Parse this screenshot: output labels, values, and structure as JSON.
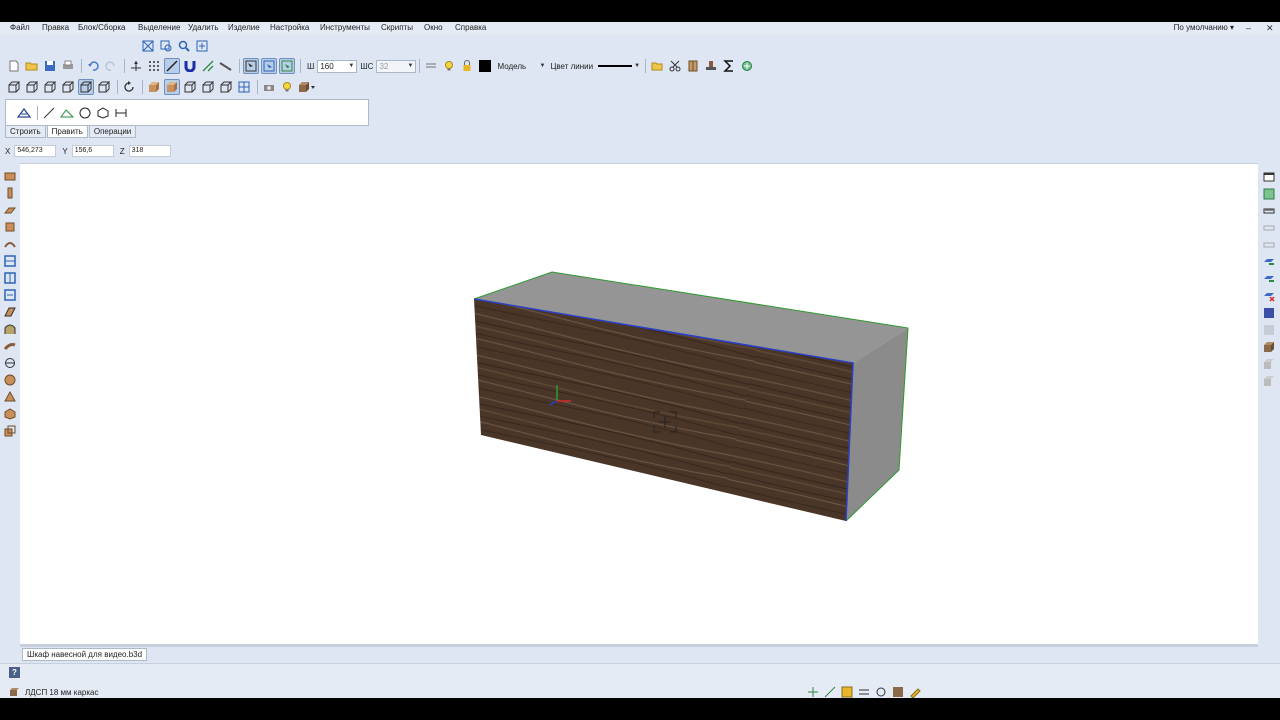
{
  "menu": [
    "Файл",
    "Правка",
    "Блок/Сборка",
    "Выделение",
    "Удалить",
    "Изделие",
    "Настройка",
    "Инструменты",
    "Скрипты",
    "Окно",
    "Справка"
  ],
  "preset": "По умолчанию ▾",
  "window_controls": {
    "minimize": "–",
    "close": "✕"
  },
  "toolbar": {
    "width_label": "Ш",
    "width_value": "160",
    "ws_label": "ШС",
    "ws_value": "32",
    "layer_value": "Модель",
    "line_color_label": "Цвет линии"
  },
  "draw_tabs": [
    "Строить",
    "Править",
    "Операции"
  ],
  "coords": {
    "x_label": "X",
    "x_value": "546,273",
    "y_label": "Y",
    "y_value": "156,6",
    "z_label": "Z",
    "z_value": "318"
  },
  "document_tab": "Шкаф навесной для видео.b3d",
  "status": {
    "help": "?",
    "material": "ЛДСП 18 мм каркас"
  },
  "colors": {
    "wood": "#4a3628",
    "panel_gray": "#8f8f8f",
    "edge_green": "#2e9a2e",
    "edge_blue": "#2a3fc4"
  }
}
